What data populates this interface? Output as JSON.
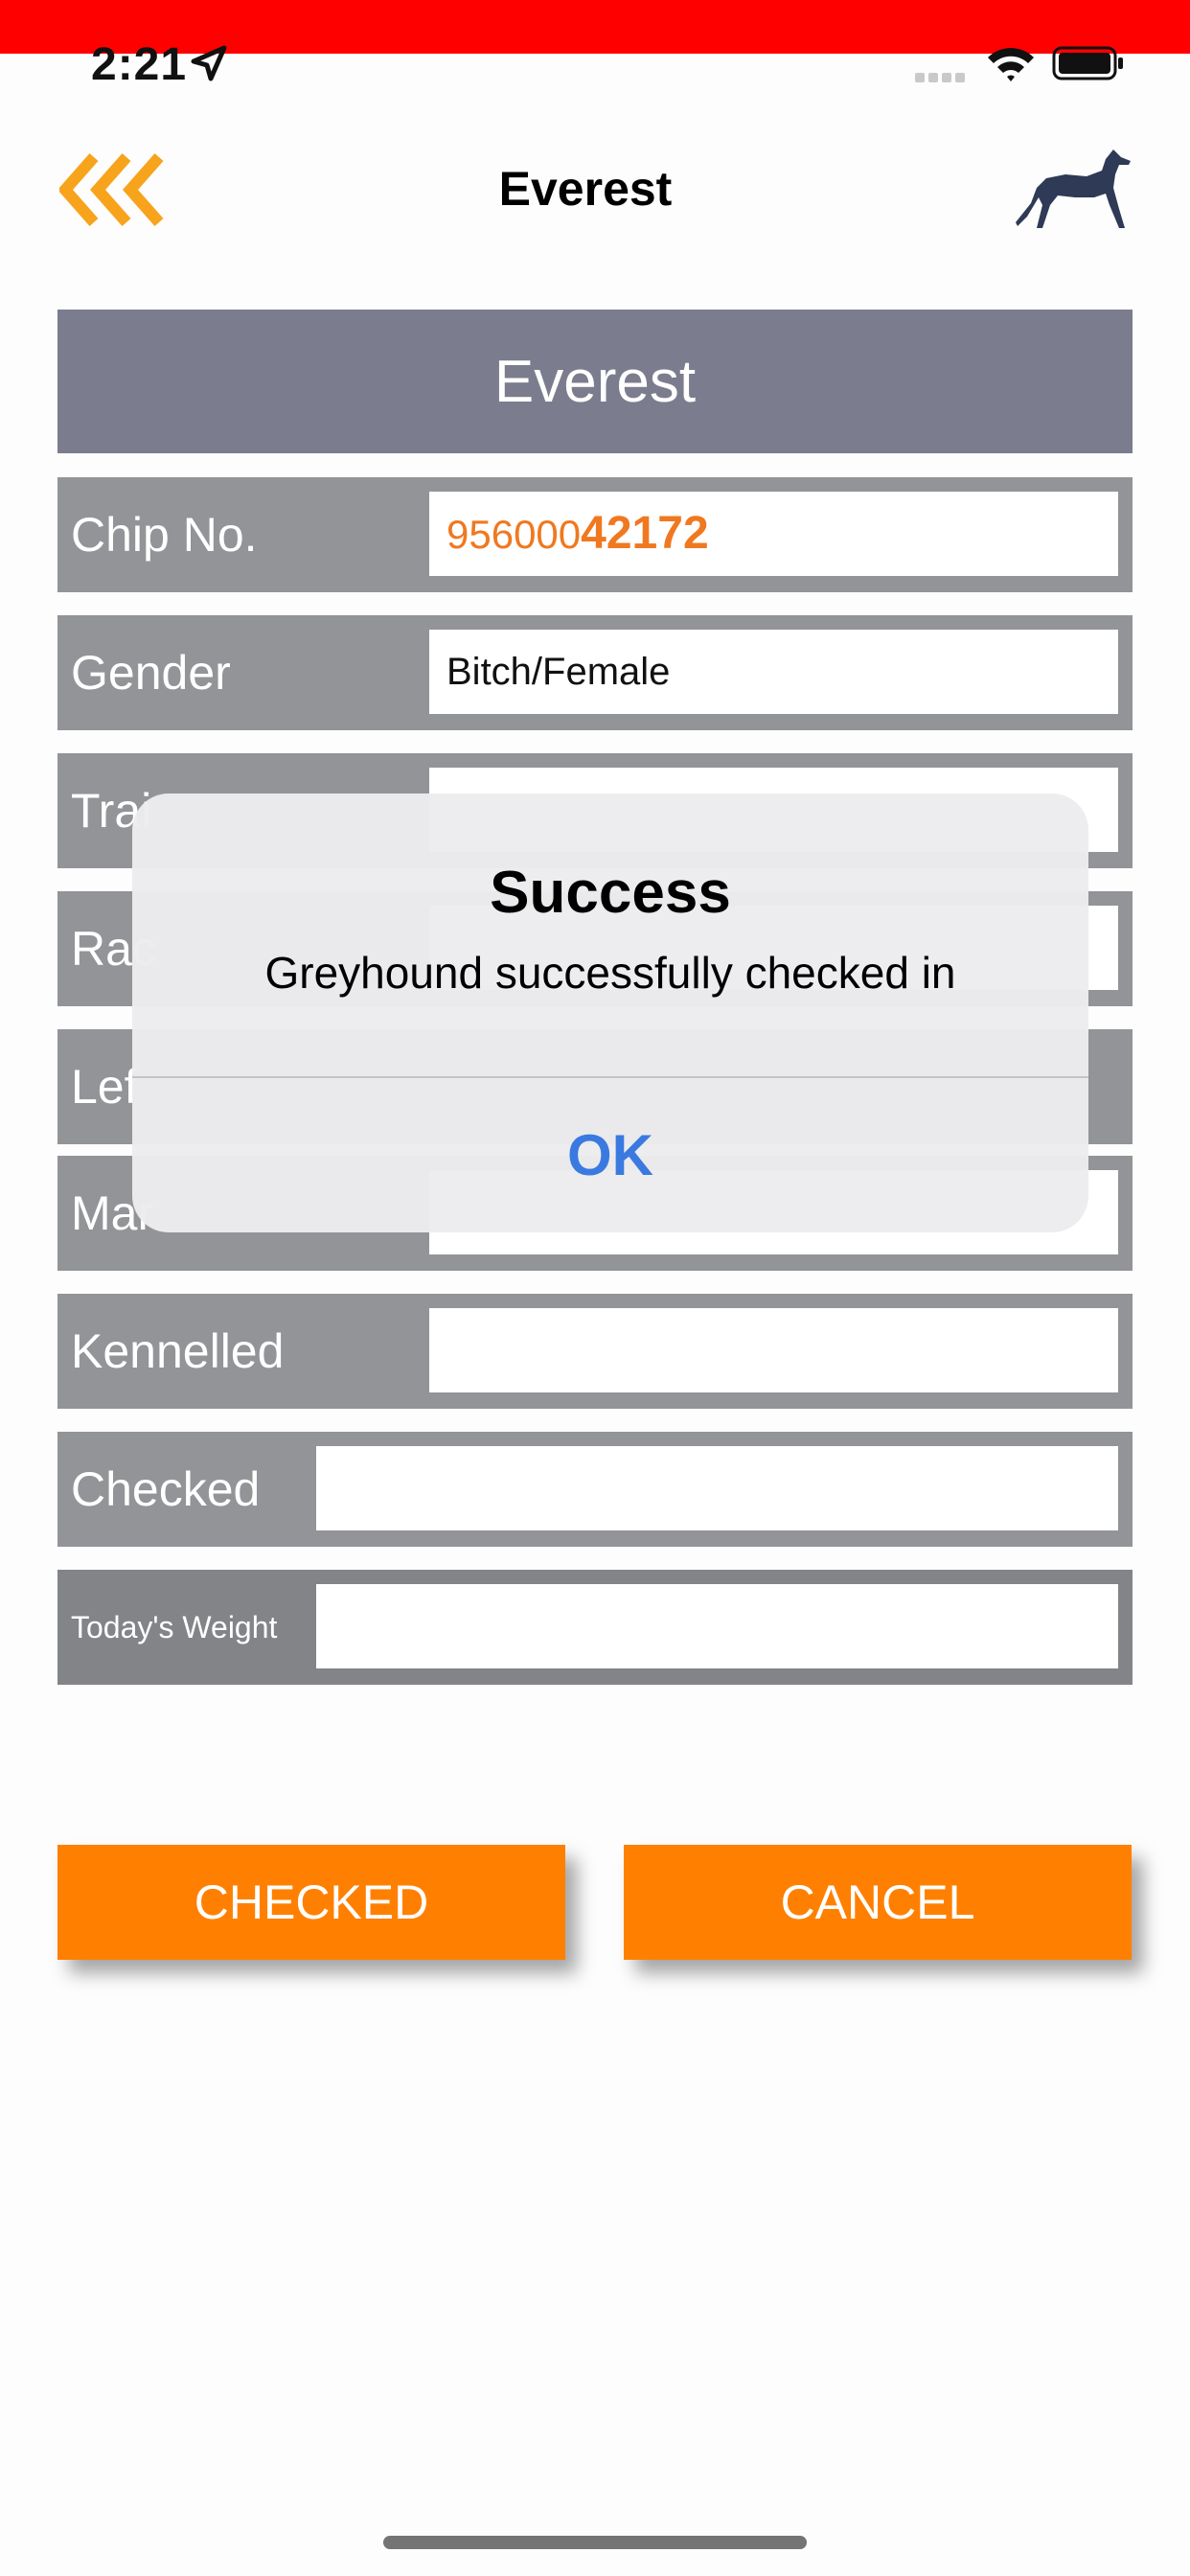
{
  "status_bar": {
    "time": "2:21"
  },
  "nav": {
    "title": "Everest"
  },
  "header": {
    "title": "Everest"
  },
  "fields": {
    "chip_label": "Chip No.",
    "chip_prefix": "956000",
    "chip_suffix": "42172",
    "gender_label": "Gender",
    "gender_value": "Bitch/Female",
    "trainer_label": "Trai",
    "race_label": "Rac",
    "left_label": "Lef",
    "markings_label": "Mar",
    "kennelled_label": "Kennelled",
    "kennelled_value": "",
    "checked_label": "Checked",
    "checked_value": "",
    "weight_label": "Today's Weight",
    "weight_value": ""
  },
  "buttons": {
    "checked": "CHECKED",
    "cancel": "CANCEL"
  },
  "alert": {
    "title": "Success",
    "message": "Greyhound successfully checked in",
    "ok": "OK"
  },
  "colors": {
    "accent": "#ff8000",
    "status_bar": "#ff0000",
    "header_bg": "#7b7d8e",
    "row_bg": "#929497",
    "alert_button": "#3a7ae0"
  },
  "icons": {
    "back": "triple-chevron-left-icon",
    "logo": "greyhound-icon"
  }
}
